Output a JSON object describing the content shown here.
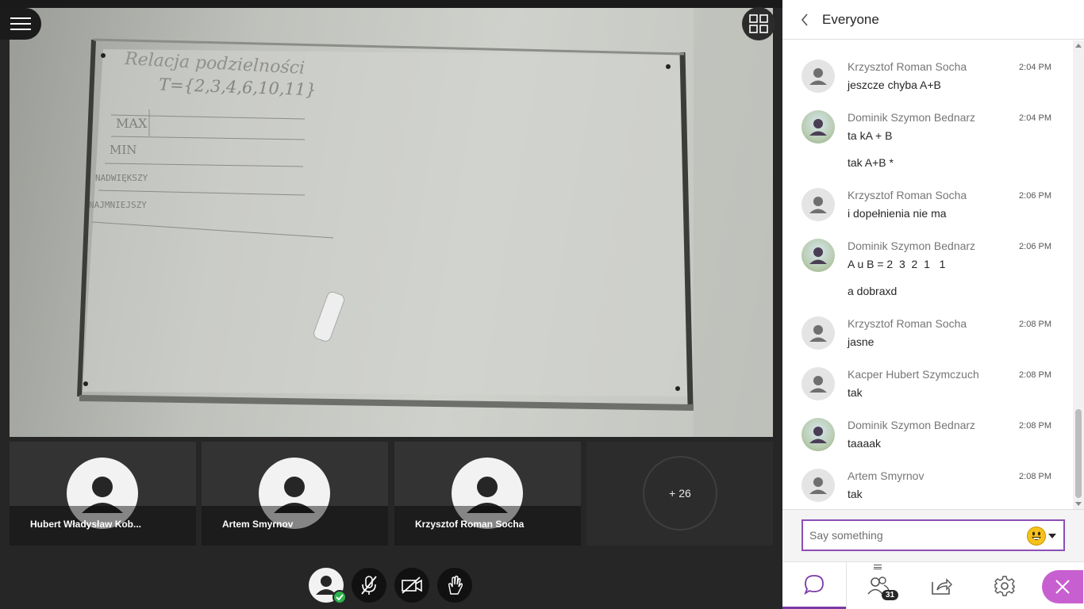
{
  "stage": {
    "menu_icon": "hamburger-menu-icon",
    "layout_icon": "grid-layout-icon",
    "whiteboard_text": {
      "title": "Relacja podzielności",
      "set": "T={2,3,4,6,10,11}",
      "rows": [
        "MAX",
        "MIN",
        "NADWIĘKSZY",
        "NAJMNIEJSZY"
      ]
    },
    "tiles": [
      {
        "name": "Hubert Władysław Kob..."
      },
      {
        "name": "Artem Smyrnov"
      },
      {
        "name": "Krzysztof Roman Socha"
      }
    ],
    "more_participants": "+ 26",
    "controls": {
      "avatar_status": "online",
      "mic_icon": "microphone-muted-icon",
      "camera_icon": "camera-off-icon",
      "hand_icon": "raise-hand-icon"
    }
  },
  "panel": {
    "title": "Everyone",
    "messages": [
      {
        "author": "Krzysztof Roman Socha",
        "time": "2:04 PM",
        "avatar": "default",
        "lines": [
          "jeszcze chyba A+B"
        ]
      },
      {
        "author": "Dominik Szymon Bednarz",
        "time": "2:04 PM",
        "avatar": "photo",
        "lines": [
          "ta kA + B",
          "tak A+B *"
        ]
      },
      {
        "author": "Krzysztof Roman Socha",
        "time": "2:06 PM",
        "avatar": "default",
        "lines": [
          "i dopełnienia nie ma"
        ]
      },
      {
        "author": "Dominik Szymon Bednarz",
        "time": "2:06 PM",
        "avatar": "photo",
        "lines": [
          "A u B = 2  3  2  1   1",
          "a dobraxd"
        ]
      },
      {
        "author": "Krzysztof Roman Socha",
        "time": "2:08 PM",
        "avatar": "default",
        "lines": [
          "jasne"
        ]
      },
      {
        "author": "Kacper Hubert Szymczuch",
        "time": "2:08 PM",
        "avatar": "default",
        "lines": [
          "tak"
        ]
      },
      {
        "author": "Dominik Szymon Bednarz",
        "time": "2:08 PM",
        "avatar": "photo",
        "lines": [
          "taaaak"
        ]
      },
      {
        "author": "Artem Smyrnov",
        "time": "2:08 PM",
        "avatar": "default",
        "lines": [
          "tak"
        ]
      }
    ],
    "input_placeholder": "Say something",
    "nav": {
      "chat_icon": "chat-bubble-icon",
      "people_icon": "attendees-icon",
      "people_count": "31",
      "share_icon": "share-content-icon",
      "settings_icon": "gear-icon",
      "close_icon": "close-icon"
    },
    "accent_color": "#7a3aa6"
  }
}
